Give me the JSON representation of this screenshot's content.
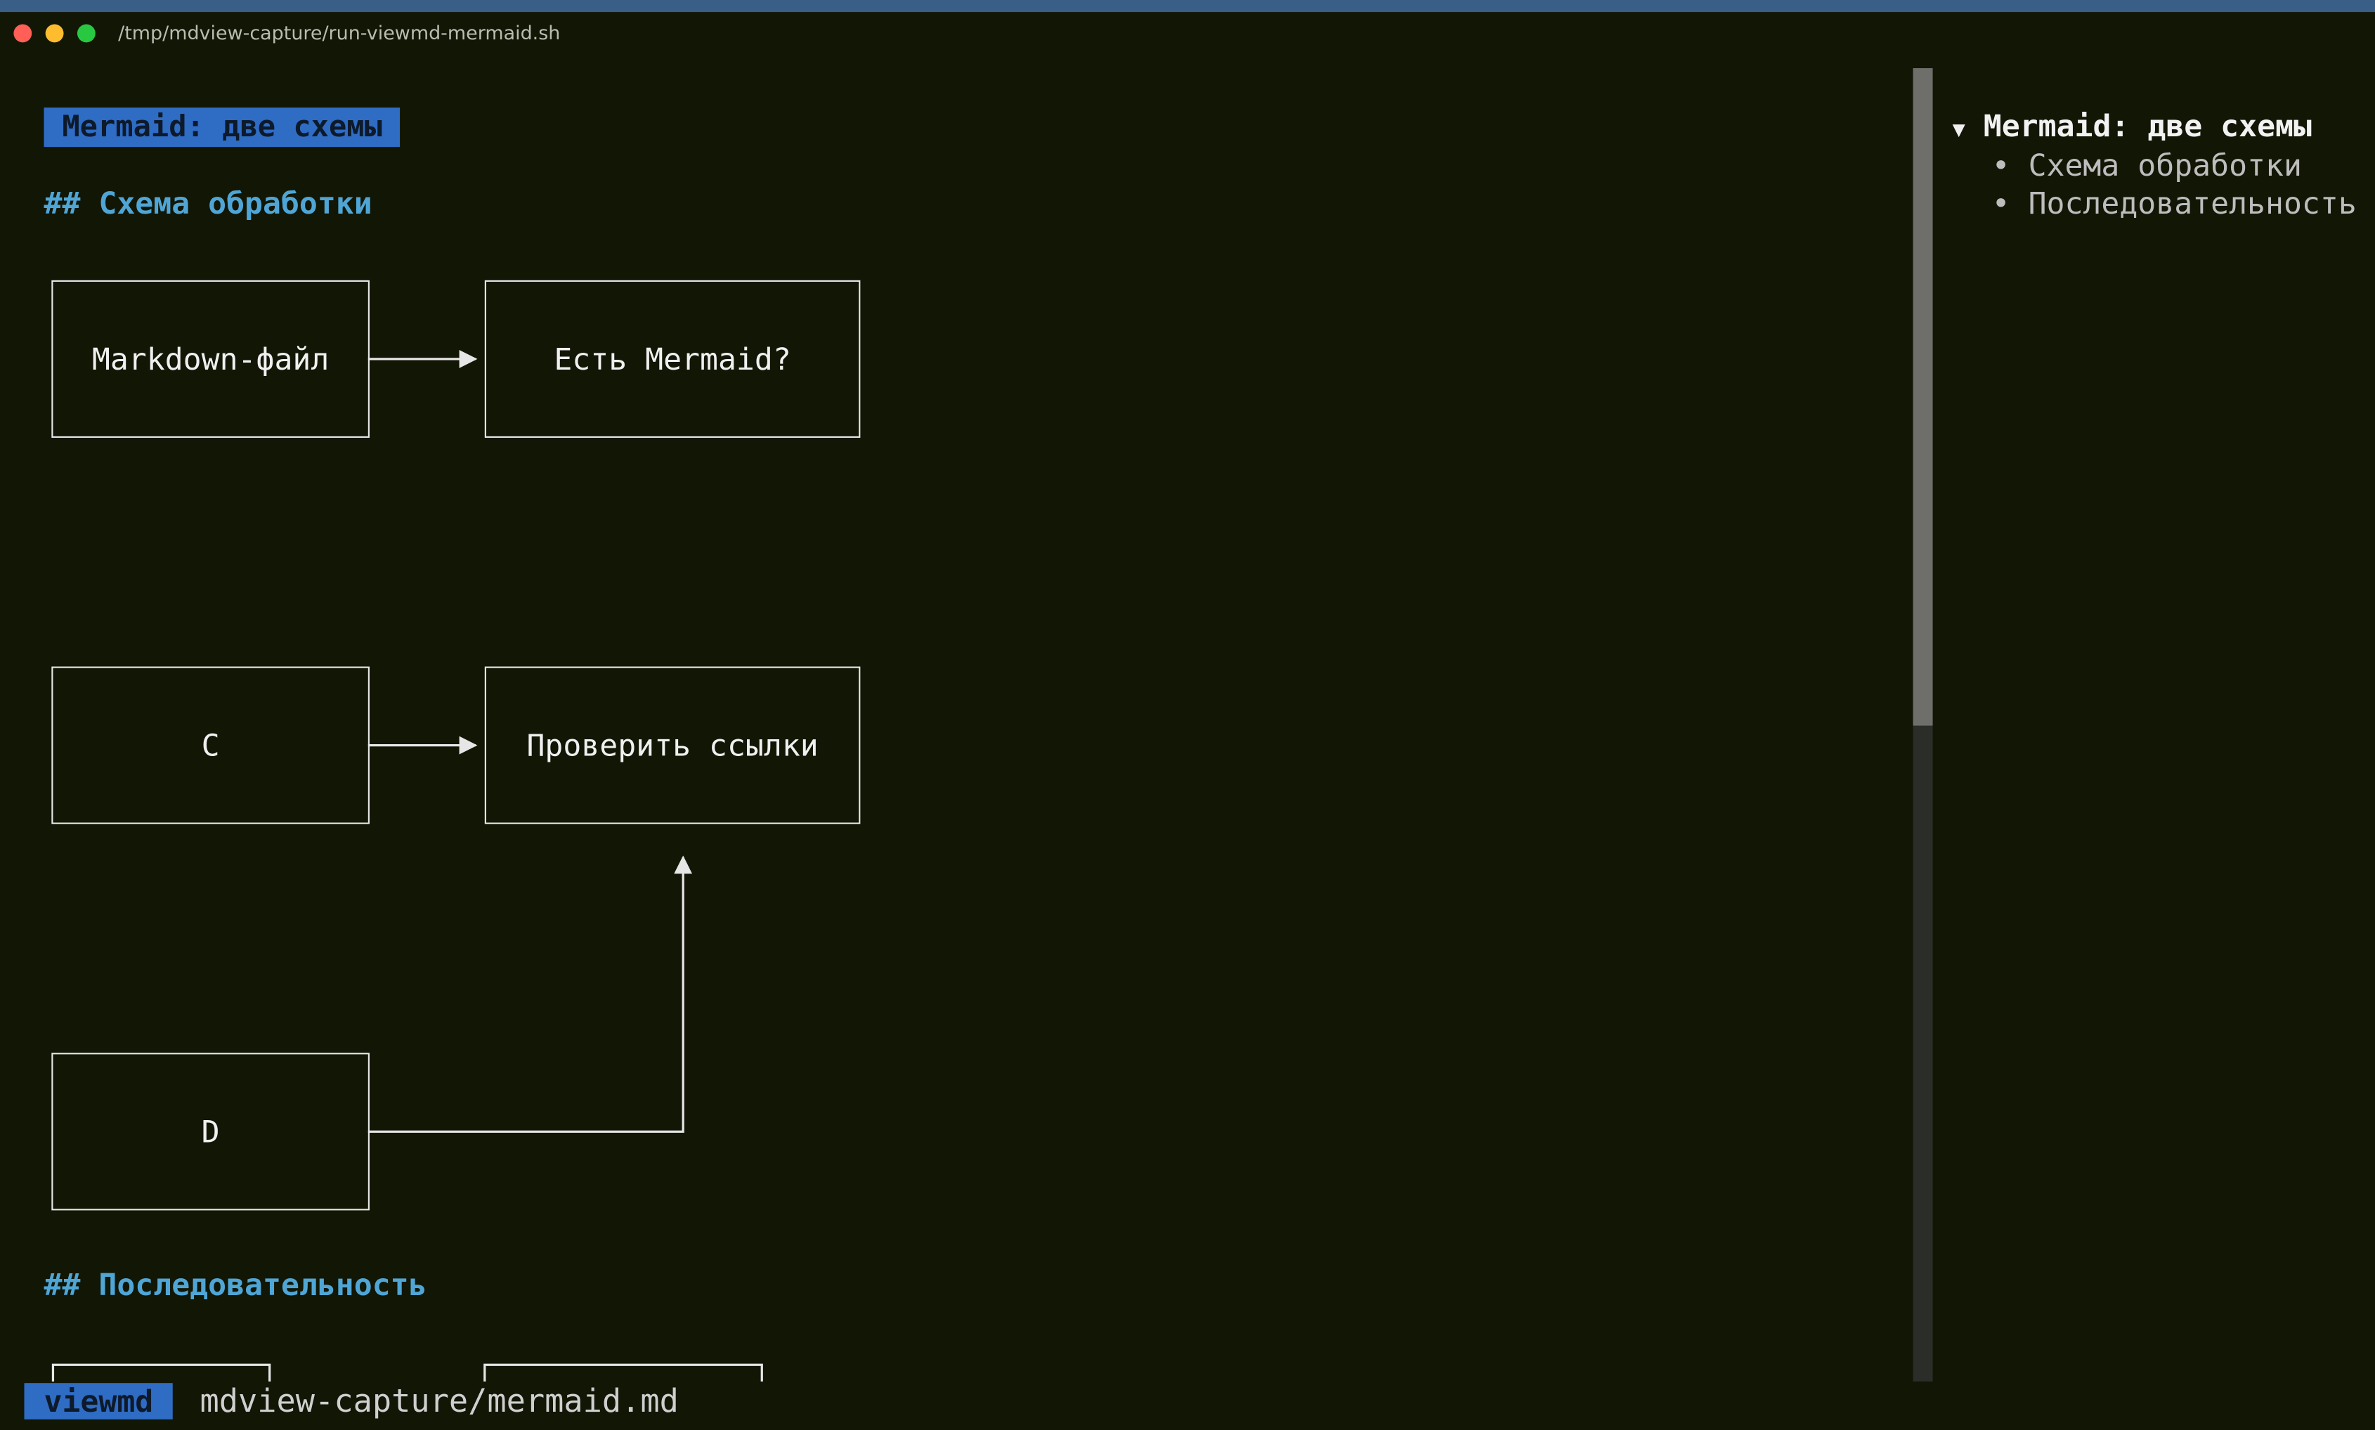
{
  "window": {
    "title": "/tmp/mdview-capture/run-viewmd-mermaid.sh"
  },
  "document": {
    "title": "Mermaid: две схемы",
    "sections": [
      {
        "heading": "## Схема обработки"
      },
      {
        "heading": "## Последовательность"
      }
    ]
  },
  "diagram": {
    "nodes": [
      {
        "id": "A",
        "label": "Markdown-файл"
      },
      {
        "id": "B",
        "label": "Есть Mermaid?"
      },
      {
        "id": "C",
        "label": "C"
      },
      {
        "id": "E",
        "label": "Проверить ссылки"
      },
      {
        "id": "D",
        "label": "D"
      }
    ],
    "edges": [
      {
        "from": "A",
        "to": "B"
      },
      {
        "from": "C",
        "to": "E"
      },
      {
        "from": "D",
        "to": "E"
      }
    ]
  },
  "toc": {
    "expand_glyph": "▼",
    "bullet_glyph": "•",
    "title": "Mermaid: две схемы",
    "items": [
      "Схема обработки",
      "Последовательность"
    ]
  },
  "status": {
    "app": "viewmd",
    "path": "mdview-capture/mermaid.md"
  },
  "colors": {
    "background": "#121605",
    "accent": "#2f6cc4",
    "heading": "#4fa6d6"
  }
}
